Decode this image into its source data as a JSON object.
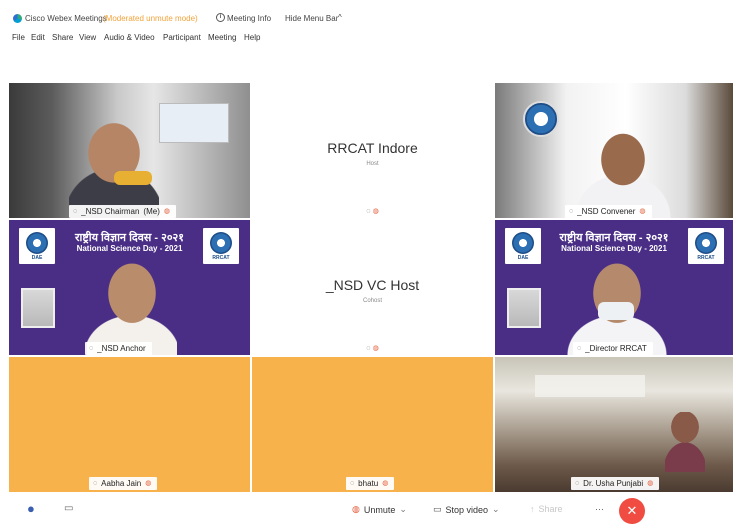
{
  "titlebar": {
    "app_name": "Cisco Webex Meetings",
    "mode": "(Moderated unmute mode)",
    "meeting_info": "Meeting Info",
    "hide_menu_bar": "Hide Menu Bar",
    "chevron": "^"
  },
  "menu": [
    "File",
    "Edit",
    "Share",
    "View",
    "Audio & Video",
    "Participant",
    "Meeting",
    "Help"
  ],
  "participants": {
    "chairman": {
      "name": "_NSD Chairman",
      "tag": "(Me)"
    },
    "rrcat_indore": {
      "name": "RRCAT Indore",
      "role": "Host"
    },
    "convener": {
      "name": "_NSD Convener"
    },
    "anchor": {
      "name": "_NSD Anchor"
    },
    "vc_host": {
      "name": "_NSD VC Host",
      "role": "Cohost"
    },
    "director": {
      "name": "_Director RRCAT"
    },
    "aabha": {
      "name": "Aabha Jain"
    },
    "bhatu": {
      "name": "bhatu"
    },
    "usha": {
      "name": "Dr. Usha Punjabi"
    }
  },
  "banner": {
    "hindi_title": "राष्ट्रीय विज्ञान दिवस - २०२१",
    "english_title": "National Science Day - 2021",
    "dae_label": "DAE",
    "rrcat_label": "RRCAT"
  },
  "controls": {
    "unmute": "Unmute",
    "stop_video": "Stop video",
    "share": "Share",
    "more": "···",
    "dropdown": "⌄"
  },
  "colors": {
    "orange_tile": "#f8b24c",
    "banner_purple": "#4a2e86",
    "end_button": "#f04c41",
    "mode_text": "#f2a33a"
  }
}
